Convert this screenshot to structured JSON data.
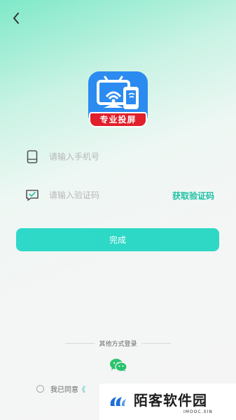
{
  "header": {
    "back_icon": "chevron-left-icon"
  },
  "logo": {
    "badge_text": "专业投屏",
    "colors": {
      "blue": "#2b8bf0",
      "red": "#e0202b"
    }
  },
  "phone_field": {
    "icon": "phone-icon",
    "placeholder": "请输入手机号",
    "value": ""
  },
  "code_field": {
    "icon": "message-check-icon",
    "placeholder": "请输入验证码",
    "value": "",
    "get_code_label": "获取验证码"
  },
  "submit": {
    "label": "完成"
  },
  "other_login": {
    "label": "其他方式登录",
    "wechat_icon": "wechat-icon"
  },
  "agreement": {
    "text": "我已同意",
    "link_start": "《"
  },
  "watermark": {
    "title": "陌客软件园",
    "subtitle": "IMOOC.XIN"
  },
  "colors": {
    "accent": "#1fc1a6",
    "button": "#2fd9c9"
  }
}
